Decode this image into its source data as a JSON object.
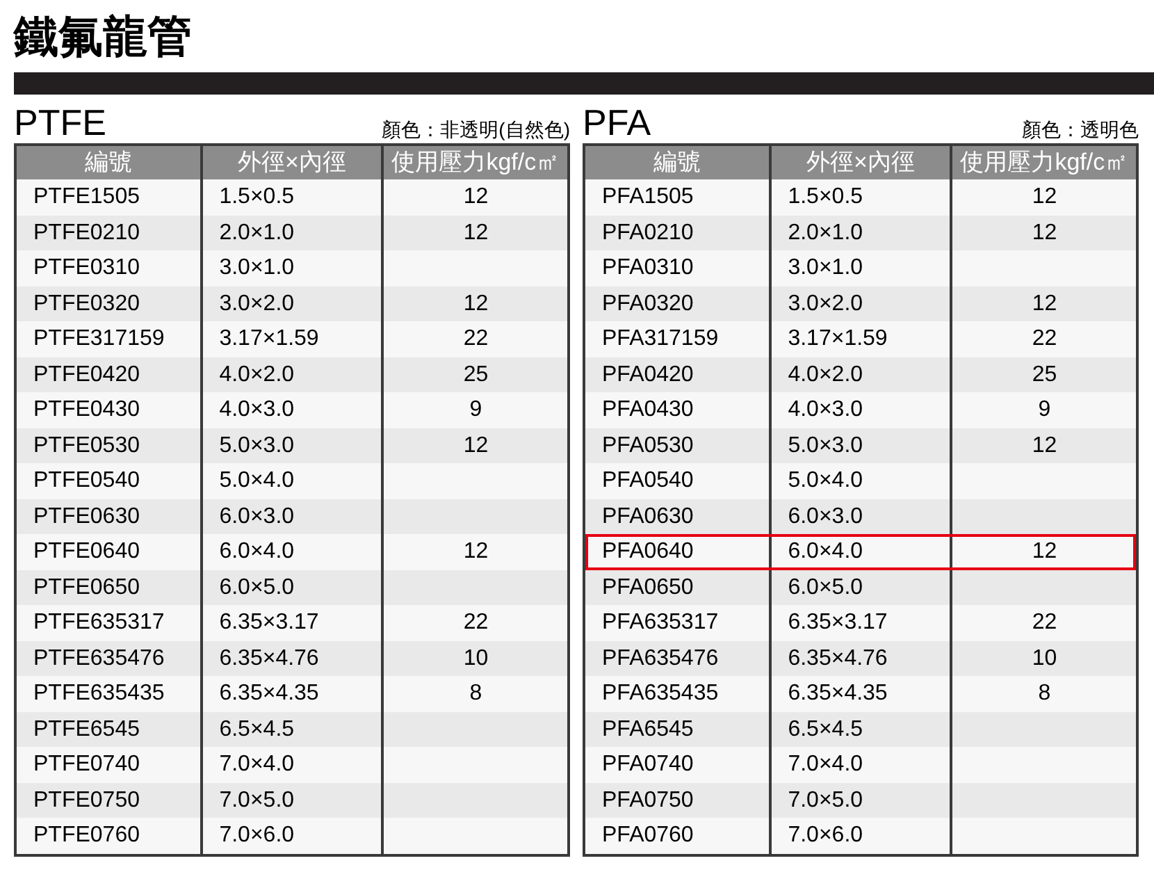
{
  "title": "鐵氟龍管",
  "tables": [
    {
      "name": "PTFE",
      "color_note": "顏色：非透明(自然色)",
      "columns": [
        "編號",
        "外徑×內徑",
        "使用壓力kgf/c㎡"
      ],
      "rows": [
        {
          "code": "PTFE1505",
          "size": "1.5×0.5",
          "pressure": "12",
          "highlighted": false
        },
        {
          "code": "PTFE0210",
          "size": "2.0×1.0",
          "pressure": "12",
          "highlighted": false
        },
        {
          "code": "PTFE0310",
          "size": "3.0×1.0",
          "highlighted": false
        },
        {
          "code": "PTFE0320",
          "size": "3.0×2.0",
          "pressure": "12",
          "highlighted": false
        },
        {
          "code": "PTFE317159",
          "size": "3.17×1.59",
          "pressure": "22",
          "highlighted": false
        },
        {
          "code": "PTFE0420",
          "size": "4.0×2.0",
          "pressure": "25",
          "highlighted": false
        },
        {
          "code": "PTFE0430",
          "size": "4.0×3.0",
          "pressure": "9",
          "highlighted": false
        },
        {
          "code": "PTFE0530",
          "size": "5.0×3.0",
          "pressure": "12",
          "highlighted": false
        },
        {
          "code": "PTFE0540",
          "size": "5.0×4.0",
          "highlighted": false
        },
        {
          "code": "PTFE0630",
          "size": "6.0×3.0",
          "highlighted": false
        },
        {
          "code": "PTFE0640",
          "size": "6.0×4.0",
          "pressure": "12",
          "highlighted": false
        },
        {
          "code": "PTFE0650",
          "size": "6.0×5.0",
          "highlighted": false
        },
        {
          "code": "PTFE635317",
          "size": "6.35×3.17",
          "pressure": "22",
          "highlighted": false
        },
        {
          "code": "PTFE635476",
          "size": "6.35×4.76",
          "pressure": "10",
          "highlighted": false
        },
        {
          "code": "PTFE635435",
          "size": "6.35×4.35",
          "pressure": "8",
          "highlighted": false
        },
        {
          "code": "PTFE6545",
          "size": "6.5×4.5",
          "highlighted": false
        },
        {
          "code": "PTFE0740",
          "size": "7.0×4.0",
          "highlighted": false
        },
        {
          "code": "PTFE0750",
          "size": "7.0×5.0",
          "highlighted": false
        },
        {
          "code": "PTFE0760",
          "size": "7.0×6.0",
          "highlighted": false
        }
      ]
    },
    {
      "name": "PFA",
      "color_note": "顏色：透明色",
      "columns": [
        "編號",
        "外徑×內徑",
        "使用壓力kgf/c㎡"
      ],
      "rows": [
        {
          "code": "PFA1505",
          "size": "1.5×0.5",
          "pressure": "12",
          "highlighted": false
        },
        {
          "code": "PFA0210",
          "size": "2.0×1.0",
          "pressure": "12",
          "highlighted": false
        },
        {
          "code": "PFA0310",
          "size": "3.0×1.0",
          "highlighted": false
        },
        {
          "code": "PFA0320",
          "size": "3.0×2.0",
          "pressure": "12",
          "highlighted": false
        },
        {
          "code": "PFA317159",
          "size": "3.17×1.59",
          "pressure": "22",
          "highlighted": false
        },
        {
          "code": "PFA0420",
          "size": "4.0×2.0",
          "pressure": "25",
          "highlighted": false
        },
        {
          "code": "PFA0430",
          "size": "4.0×3.0",
          "pressure": "9",
          "highlighted": false
        },
        {
          "code": "PFA0530",
          "size": "5.0×3.0",
          "pressure": "12",
          "highlighted": false
        },
        {
          "code": "PFA0540",
          "size": "5.0×4.0",
          "highlighted": false
        },
        {
          "code": "PFA0630",
          "size": "6.0×3.0",
          "highlighted": false
        },
        {
          "code": "PFA0640",
          "size": "6.0×4.0",
          "pressure": "12",
          "highlighted": true
        },
        {
          "code": "PFA0650",
          "size": "6.0×5.0",
          "highlighted": false
        },
        {
          "code": "PFA635317",
          "size": "6.35×3.17",
          "pressure": "22",
          "highlighted": false
        },
        {
          "code": "PFA635476",
          "size": "6.35×4.76",
          "pressure": "10",
          "highlighted": false
        },
        {
          "code": "PFA635435",
          "size": "6.35×4.35",
          "pressure": "8",
          "highlighted": false
        },
        {
          "code": "PFA6545",
          "size": "6.5×4.5",
          "highlighted": false
        },
        {
          "code": "PFA0740",
          "size": "7.0×4.0",
          "highlighted": false
        },
        {
          "code": "PFA0750",
          "size": "7.0×5.0",
          "highlighted": false
        },
        {
          "code": "PFA0760",
          "size": "7.0×6.0",
          "highlighted": false
        }
      ]
    }
  ]
}
